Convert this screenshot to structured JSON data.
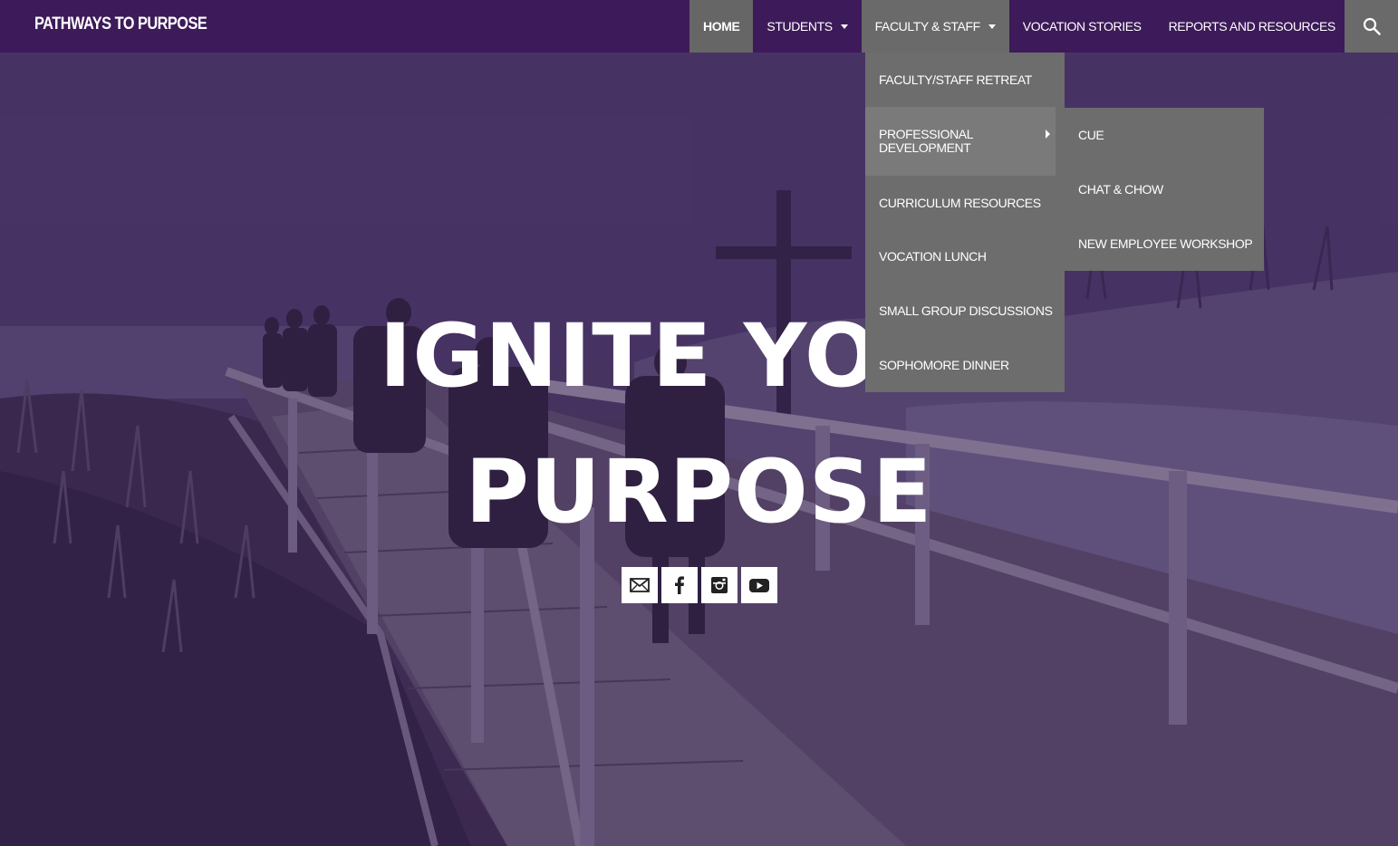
{
  "site": {
    "brand": "PATHWAYS TO PURPOSE"
  },
  "nav": {
    "items": [
      {
        "label": "HOME",
        "state": "active"
      },
      {
        "label": "STUDENTS",
        "has_dropdown": true
      },
      {
        "label": "FACULTY & STAFF",
        "has_dropdown": true,
        "state": "open"
      },
      {
        "label": "VOCATION STORIES"
      },
      {
        "label": "REPORTS AND RESOURCES"
      }
    ],
    "search_icon": "search-icon"
  },
  "faculty_dropdown": {
    "items": [
      {
        "label": "FACULTY/STAFF RETREAT"
      },
      {
        "label": "PROFESSIONAL DEVELOPMENT",
        "has_submenu": true
      },
      {
        "label": "CURRICULUM RESOURCES"
      },
      {
        "label": "VOCATION LUNCH"
      },
      {
        "label": "SMALL GROUP DISCUSSIONS"
      },
      {
        "label": "SOPHOMORE DINNER"
      }
    ]
  },
  "professional_development_submenu": {
    "items": [
      {
        "label": "CUE"
      },
      {
        "label": "CHAT & CHOW"
      },
      {
        "label": "NEW EMPLOYEE WORKSHOP"
      }
    ]
  },
  "hero": {
    "headline_line1": "IGNITE YOUR",
    "headline_line2": "PURPOSE"
  },
  "social": [
    {
      "name": "email",
      "icon": "envelope-icon"
    },
    {
      "name": "facebook",
      "icon": "facebook-icon"
    },
    {
      "name": "instagram",
      "icon": "instagram-icon"
    },
    {
      "name": "youtube",
      "icon": "youtube-icon"
    }
  ],
  "colors": {
    "navbar": "#3d1a59",
    "active_tab": "#666666",
    "dropdown": "#6d6d6d",
    "hero_tint": "#4a3a66"
  }
}
